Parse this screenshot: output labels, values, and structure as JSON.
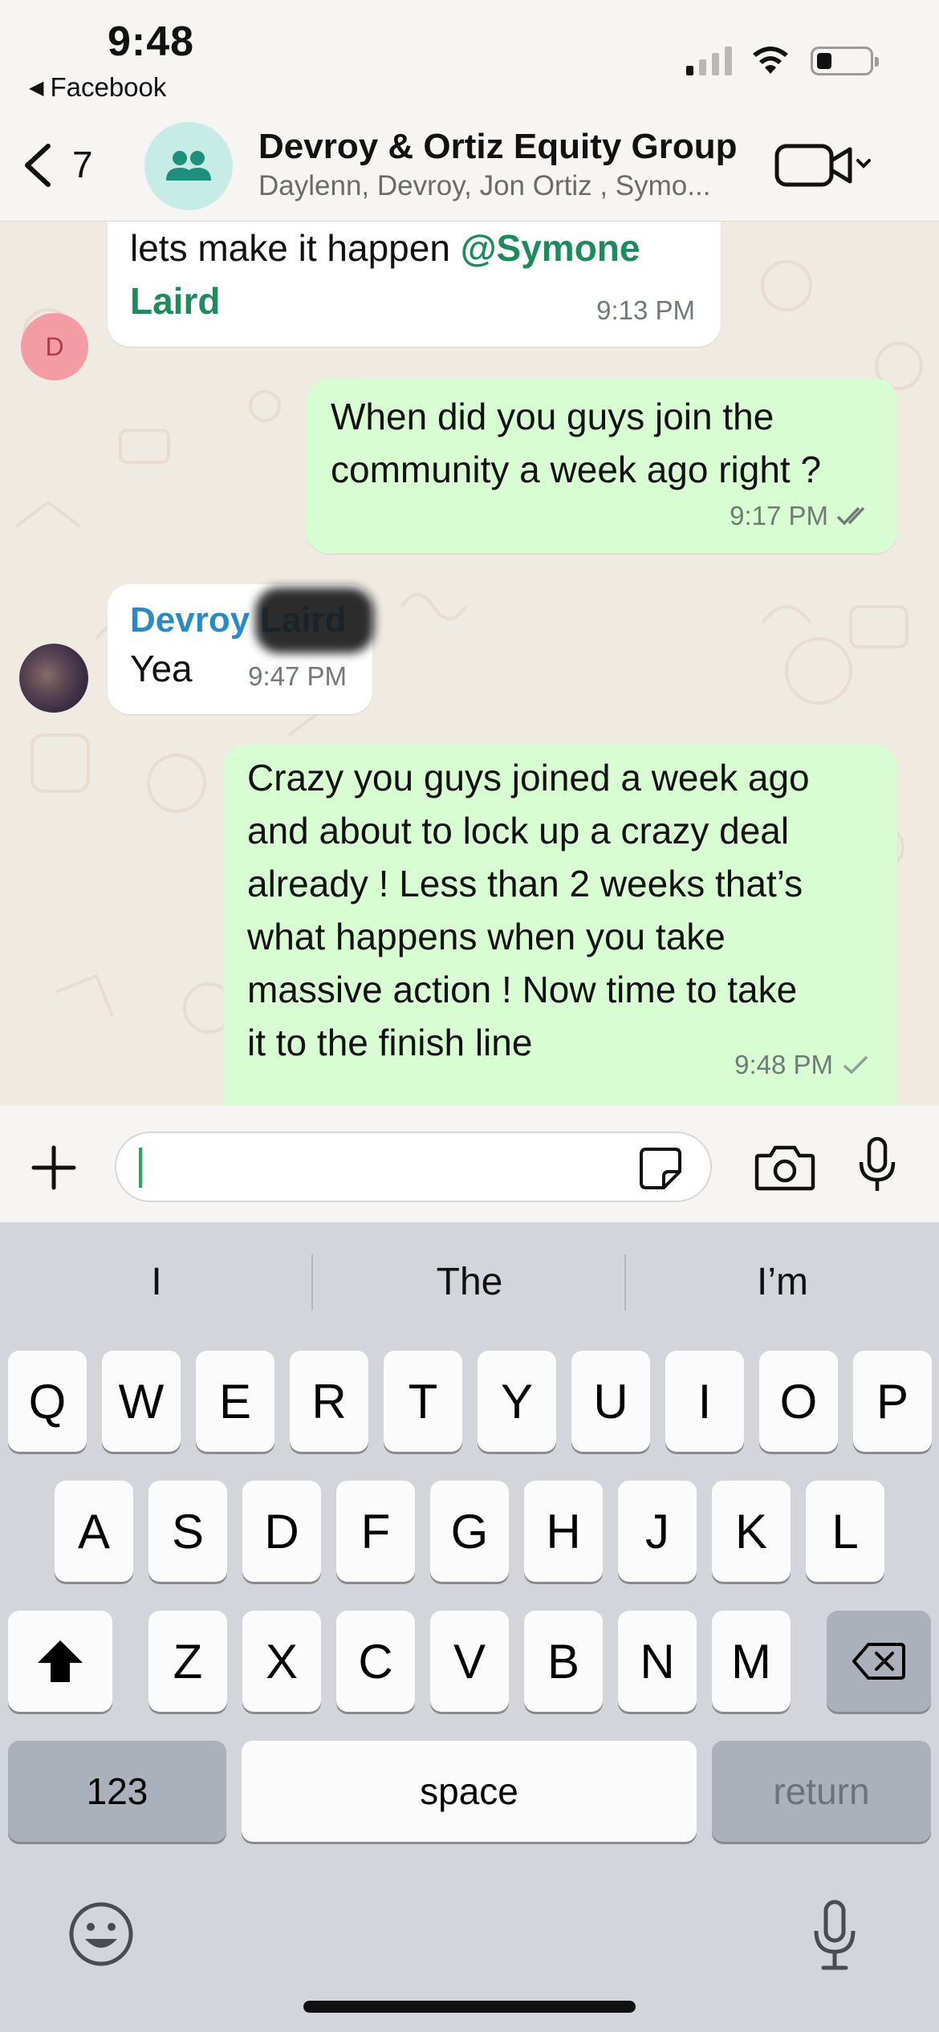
{
  "status_bar": {
    "time": "9:48",
    "back_app": "Facebook"
  },
  "header": {
    "unread_count": "7",
    "title": "Devroy & Ortiz Equity Group",
    "subtitle": "Daylenn, Devroy, Jon Ortiz , Symo...",
    "group_avatar_icon": "group-icon",
    "video_icon": "video-call-icon"
  },
  "messages": [
    {
      "direction": "in",
      "sender_initial": "D",
      "text_plain": "lets make it happen ",
      "mention": "@Symone",
      "mention_cont": "Laird",
      "time": "9:13 PM"
    },
    {
      "direction": "out",
      "line1": "When did you guys join the",
      "line2": "community a week ago right ?",
      "time": "9:17 PM",
      "status": "read"
    },
    {
      "direction": "in",
      "sender_first": "Devroy",
      "sender_last": "Laird",
      "text": "Yea",
      "time": "9:47 PM"
    },
    {
      "direction": "out",
      "lines": [
        "Crazy you guys joined a week ago",
        "and about to lock up a crazy deal",
        "already ! Less than 2 weeks that’s",
        "what happens when you take",
        "massive action ! Now time to take",
        "it to the finish line"
      ],
      "time": "9:48 PM",
      "status": "sent"
    }
  ],
  "composer": {
    "value": "",
    "placeholder": ""
  },
  "keyboard": {
    "suggestions": [
      "I",
      "The",
      "I’m"
    ],
    "row1": [
      "Q",
      "W",
      "E",
      "R",
      "T",
      "Y",
      "U",
      "I",
      "O",
      "P"
    ],
    "row2": [
      "A",
      "S",
      "D",
      "F",
      "G",
      "H",
      "J",
      "K",
      "L"
    ],
    "row3": [
      "Z",
      "X",
      "C",
      "V",
      "B",
      "N",
      "M"
    ],
    "numbers_label": "123",
    "space_label": "space",
    "return_label": "return"
  },
  "colors": {
    "outgoing_bubble": "#d9fdd3",
    "incoming_bubble": "#ffffff",
    "mention": "#1f8a5e",
    "sender_name": "#2a8bc4",
    "chat_background": "#efeae2"
  }
}
